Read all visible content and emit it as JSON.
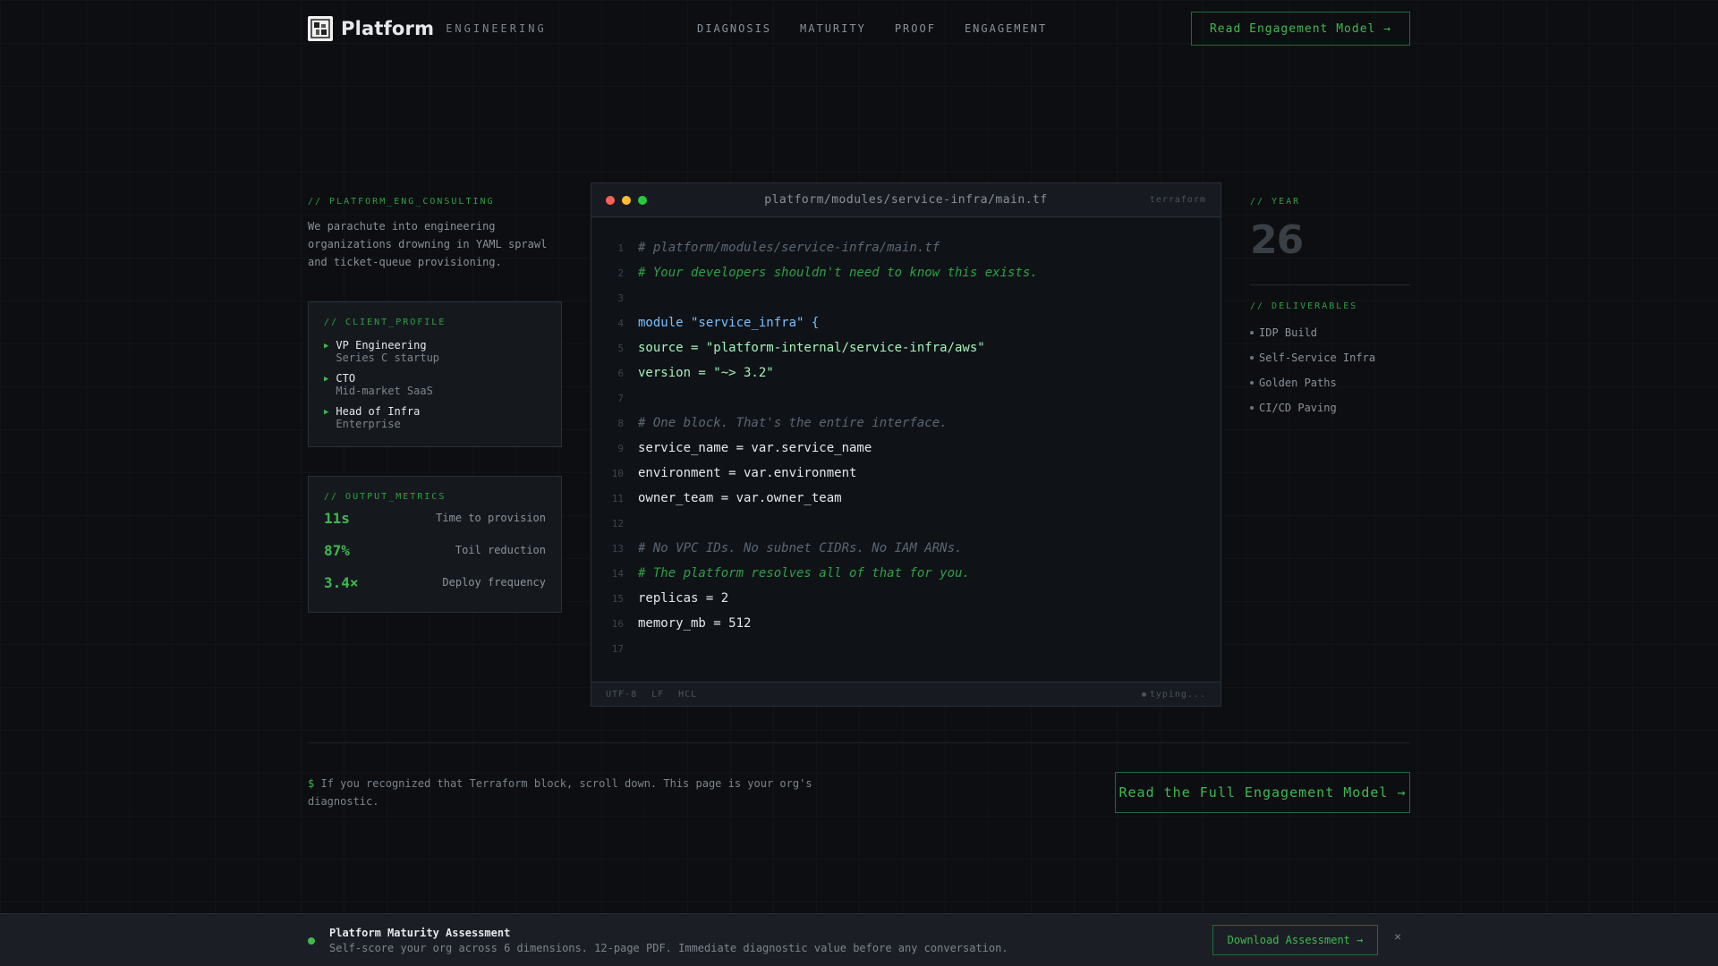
{
  "header": {
    "brand": "Platform",
    "brand_sub": "ENGINEERING",
    "nav": [
      "DIAGNOSIS",
      "MATURITY",
      "PROOF",
      "ENGAGEMENT"
    ],
    "cta": "Read Engagement Model →"
  },
  "left": {
    "tag": "// PLATFORM_ENG_CONSULTING",
    "intro": "We parachute into engineering organizations drowning in YAML sprawl and ticket-queue provisioning.",
    "profile": {
      "tag": "// CLIENT_PROFILE",
      "items": [
        {
          "role": "VP Engineering",
          "org": "Series C startup"
        },
        {
          "role": "CTO",
          "org": "Mid-market SaaS"
        },
        {
          "role": "Head of Infra",
          "org": "Enterprise"
        }
      ]
    },
    "metrics": {
      "tag": "// OUTPUT_METRICS",
      "items": [
        {
          "value": "11s",
          "label": "Time to provision"
        },
        {
          "value": "87%",
          "label": "Toil reduction"
        },
        {
          "value": "3.4×",
          "label": "Deploy frequency"
        }
      ]
    }
  },
  "editor": {
    "filename": "platform/modules/service-infra/main.tf",
    "lang": "terraform",
    "lines": [
      {
        "n": "1",
        "text": "# platform/modules/service-infra/main.tf",
        "kind": "comment"
      },
      {
        "n": "2",
        "text": "# Your developers shouldn't need to know this exists.",
        "kind": "comment-g"
      },
      {
        "n": "3",
        "text": "",
        "kind": "plain"
      },
      {
        "n": "4",
        "text": "module \"service_infra\" {",
        "kind": "kw"
      },
      {
        "n": "5",
        "text": "source = \"platform-internal/service-infra/aws\"",
        "kind": "str"
      },
      {
        "n": "6",
        "text": "version = \"~> 3.2\"",
        "kind": "str"
      },
      {
        "n": "7",
        "text": "",
        "kind": "plain"
      },
      {
        "n": "8",
        "text": "# One block. That's the entire interface.",
        "kind": "comment"
      },
      {
        "n": "9",
        "text": "service_name = var.service_name",
        "kind": "plain"
      },
      {
        "n": "10",
        "text": "environment = var.environment",
        "kind": "plain"
      },
      {
        "n": "11",
        "text": "owner_team = var.owner_team",
        "kind": "plain"
      },
      {
        "n": "12",
        "text": "",
        "kind": "plain"
      },
      {
        "n": "13",
        "text": "# No VPC IDs. No subnet CIDRs. No IAM ARNs.",
        "kind": "comment"
      },
      {
        "n": "14",
        "text": "# The platform resolves all of that for you.",
        "kind": "comment-g"
      },
      {
        "n": "15",
        "text": "replicas = 2",
        "kind": "plain"
      },
      {
        "n": "16",
        "text": "memory_mb = 512",
        "kind": "plain"
      },
      {
        "n": "17",
        "text": "",
        "kind": "plain"
      }
    ],
    "status": {
      "encoding": "UTF-8",
      "eol": "LF",
      "lang": "HCL",
      "state": "typing..."
    }
  },
  "right": {
    "year_tag": "// YEAR",
    "year": "26",
    "deliv_tag": "// DELIVERABLES",
    "deliverables": [
      "IDP Build",
      "Self-Service Infra",
      "Golden Paths",
      "CI/CD Paving"
    ]
  },
  "bottom": {
    "prompt_symbol": "$",
    "prompt_text": "If you recognized that Terraform block, scroll down. This page is your org's diagnostic.",
    "cta": "Read the Full Engagement Model →"
  },
  "banner": {
    "title": "Platform Maturity Assessment",
    "desc": "Self-score your org across 6 dimensions. 12-page PDF. Immediate diagnostic value before any conversation.",
    "button": "Download Assessment →",
    "close": "×"
  },
  "colors": {
    "accent": "#3fb950",
    "background": "#0c0e11"
  }
}
